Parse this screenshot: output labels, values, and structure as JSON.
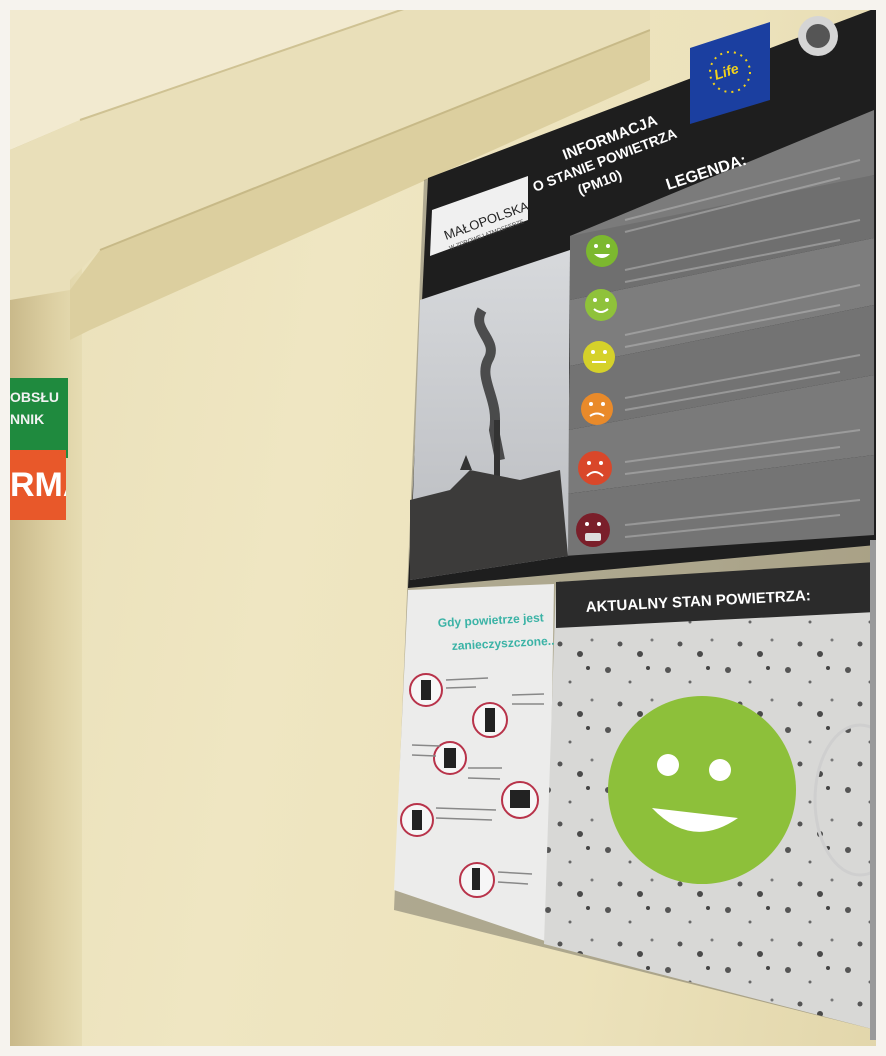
{
  "wall_signs": {
    "green_line1": "OBSŁU",
    "green_line2": "NNIK",
    "orange_text": "RMA"
  },
  "poster": {
    "title_line1": "INFORMACJA",
    "title_line2": "O STANIE POWIETRZA",
    "title_line3": "(PM10)",
    "legend_title": "LEGENDA:",
    "logo_main": "MAŁOPOLSKA",
    "logo_sub": "W ZDROWEJ ATMOSFERZE",
    "eu_logo_text": "Life",
    "current_state_title": "AKTUALNY STAN POWIETRZA:",
    "tips_title_line1": "Gdy powietrze jest",
    "tips_title_line2": "zanieczyszczone..."
  },
  "legend_levels": [
    {
      "face": "very-good",
      "color": "#7cb82f"
    },
    {
      "face": "good",
      "color": "#8fc23a"
    },
    {
      "face": "moderate",
      "color": "#d5d12a"
    },
    {
      "face": "sufficient",
      "color": "#e98a2a"
    },
    {
      "face": "bad",
      "color": "#d9472a"
    },
    {
      "face": "very-bad",
      "color": "#7a1f2a"
    }
  ],
  "current_indicator": {
    "face": "very-good",
    "color": "#8dc03a"
  }
}
